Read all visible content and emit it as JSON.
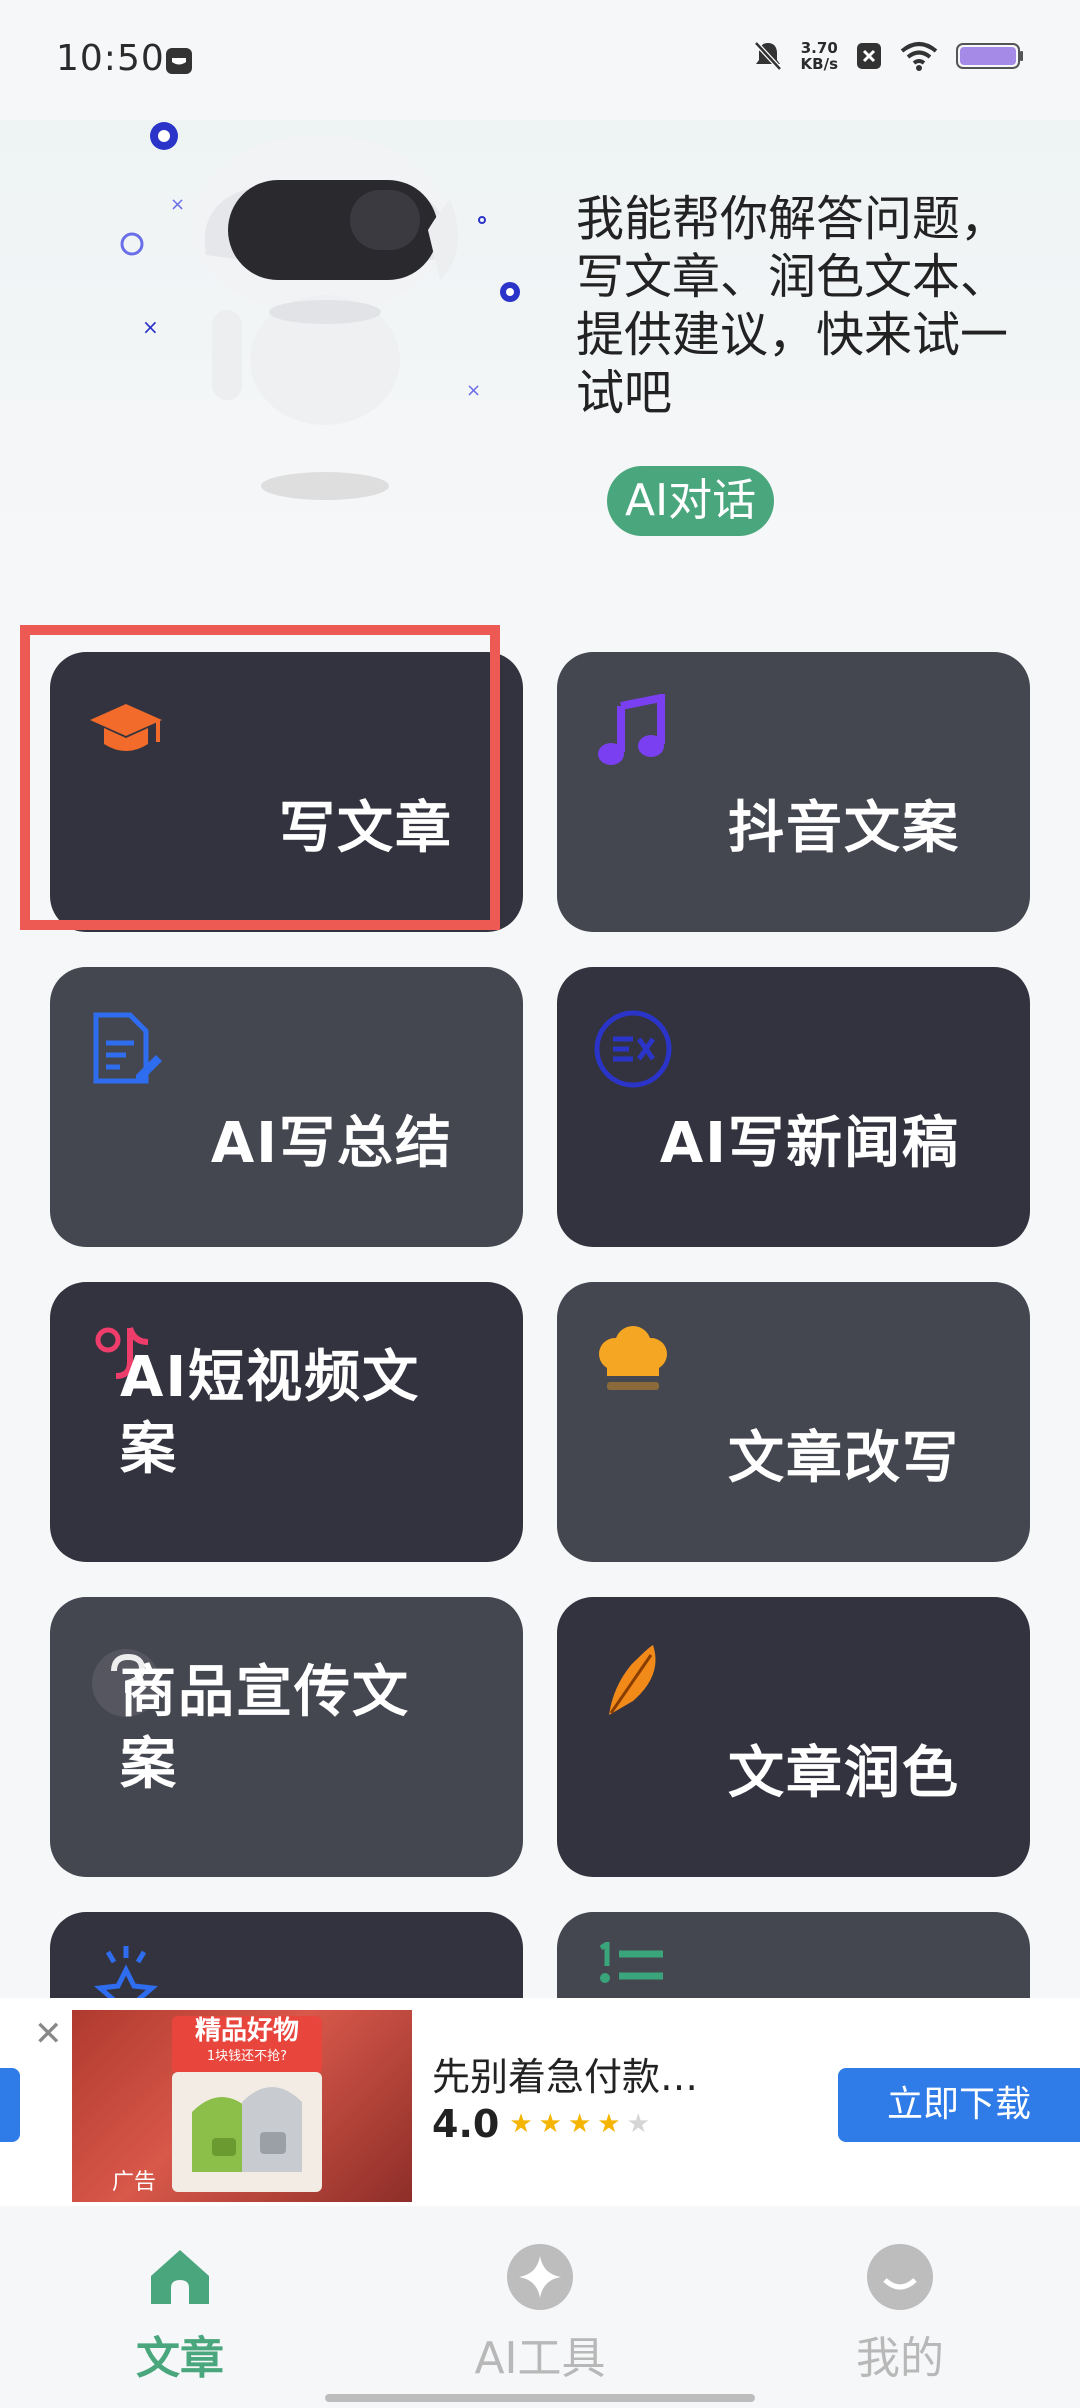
{
  "status_bar": {
    "time": "10:50",
    "net_speed_value": "3.70",
    "net_speed_unit": "KB/s"
  },
  "hero": {
    "intro_text": "我能帮你解答问题，写文章、润色文本、提供建议，快来试一试吧",
    "chat_button": "AI对话"
  },
  "cards": [
    {
      "label": "写文章",
      "icon": "graduation-cap-icon",
      "color": "#f26b2a"
    },
    {
      "label": "抖音文案",
      "icon": "music-note-icon",
      "color": "#7b3ff2"
    },
    {
      "label": "AI写总结",
      "icon": "document-edit-icon",
      "color": "#2f6df0"
    },
    {
      "label": "AI写新闻稿",
      "icon": "news-icon",
      "color": "#2b34c9"
    },
    {
      "label": "AI短视频文案",
      "icon": "tiktok-icon",
      "color": "#ee3d6a"
    },
    {
      "label": "文章改写",
      "icon": "chef-hat-icon",
      "color": "#f5a623"
    },
    {
      "label": "商品宣传文案",
      "icon": "question-icon",
      "color": "#6a6a6a"
    },
    {
      "label": "文章润色",
      "icon": "feather-icon",
      "color": "#f28a1a"
    },
    {
      "label": "",
      "icon": "sparkle-star-icon",
      "color": "#2f6df0"
    },
    {
      "label": "",
      "icon": "numbered-list-icon",
      "color": "#3aa57a"
    }
  ],
  "ad": {
    "badge_title": "精品好物",
    "badge_sub": "1块钱还不抢?",
    "ad_tag": "广告",
    "title": "先别着急付款…",
    "rating": "4.0",
    "cta": "立即下载"
  },
  "nav": {
    "items": [
      {
        "label": "文章",
        "icon": "home-icon",
        "active": true
      },
      {
        "label": "AI工具",
        "icon": "ai-tools-icon",
        "active": false
      },
      {
        "label": "我的",
        "icon": "profile-icon",
        "active": false
      }
    ]
  },
  "colors": {
    "accent_green": "#4aa77d",
    "card_dark": "#33333f",
    "card_light": "#444650",
    "highlight_red": "#ec5a53",
    "cta_blue": "#2f7be8"
  }
}
